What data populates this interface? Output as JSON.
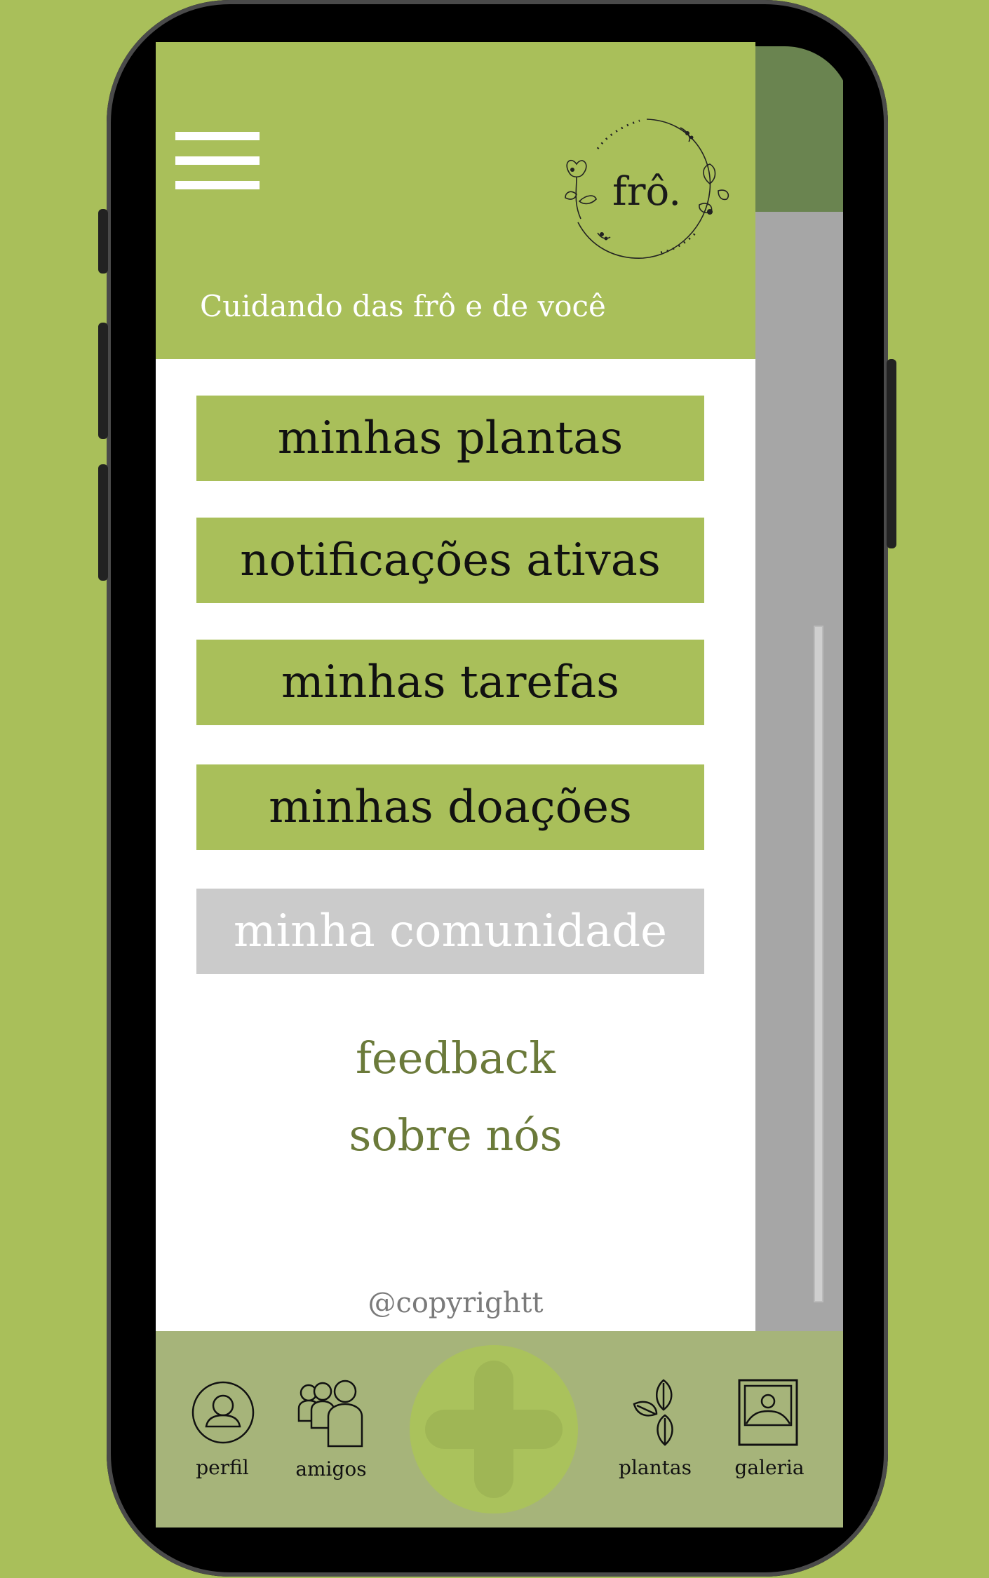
{
  "app": {
    "logo_text": "frô.",
    "tagline": "Cuidando das frô e de você"
  },
  "menu": {
    "items": [
      {
        "label": "minhas plantas",
        "enabled": true
      },
      {
        "label": "notificações ativas",
        "enabled": true
      },
      {
        "label": "minhas tarefas",
        "enabled": true
      },
      {
        "label": "minhas doações",
        "enabled": true
      },
      {
        "label": "minha comunidade",
        "enabled": false
      }
    ],
    "links": [
      {
        "label": "feedback"
      },
      {
        "label": "sobre nós"
      }
    ],
    "copyright": "@copyrightt"
  },
  "bottom_nav": {
    "items": [
      {
        "label": "perfil",
        "icon": "user-circle-icon"
      },
      {
        "label": "amigos",
        "icon": "people-icon"
      },
      {
        "label": "plantas",
        "icon": "leaves-icon"
      },
      {
        "label": "galeria",
        "icon": "picture-icon"
      }
    ],
    "center_button_icon": "plus-icon"
  },
  "colors": {
    "background": "#a9bf5a",
    "header": "#a9bf5a",
    "button": "#a9bf5a",
    "button_disabled": "#cbcbcb",
    "link": "#6b7a3a",
    "navbar": "#a6b47a"
  }
}
